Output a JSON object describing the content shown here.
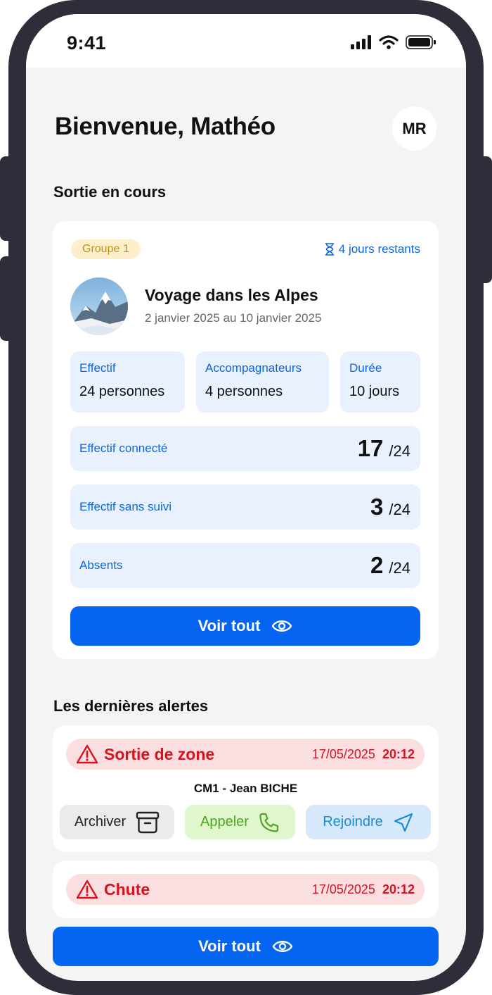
{
  "status_bar": {
    "time": "9:41"
  },
  "header": {
    "title": "Bienvenue, Mathéo",
    "avatar_initials": "MR"
  },
  "current_trip": {
    "section_title": "Sortie en cours",
    "group": "Groupe 1",
    "days_left": "4 jours restants",
    "name": "Voyage dans les Alpes",
    "dates": "2 janvier 2025 au 10 janvier 2025",
    "info": [
      {
        "label": "Effectif",
        "value": "24 personnes"
      },
      {
        "label": "Accompagnateurs",
        "value": "4 personnes"
      },
      {
        "label": "Durée",
        "value": "10 jours"
      }
    ],
    "stats": [
      {
        "label": "Effectif connecté",
        "value": "17",
        "total": "/24"
      },
      {
        "label": "Effectif sans suivi",
        "value": "3",
        "total": "/24"
      },
      {
        "label": "Absents",
        "value": "2",
        "total": "/24"
      }
    ],
    "see_all": "Voir tout"
  },
  "alerts": {
    "section_title": "Les dernières alertes",
    "items": [
      {
        "type": "Sortie de zone",
        "date": "17/05/2025",
        "time": "20:12",
        "person": "CM1 - Jean BICHE",
        "actions": {
          "archive": "Archiver",
          "call": "Appeler",
          "join": "Rejoindre"
        }
      },
      {
        "type": "Chute",
        "date": "17/05/2025",
        "time": "20:12"
      }
    ],
    "see_all": "Voir tout"
  },
  "colors": {
    "primary": "#0565f0",
    "alert": "#d8121f",
    "badge": "#c28f16",
    "frame": "#2e2d3a"
  }
}
